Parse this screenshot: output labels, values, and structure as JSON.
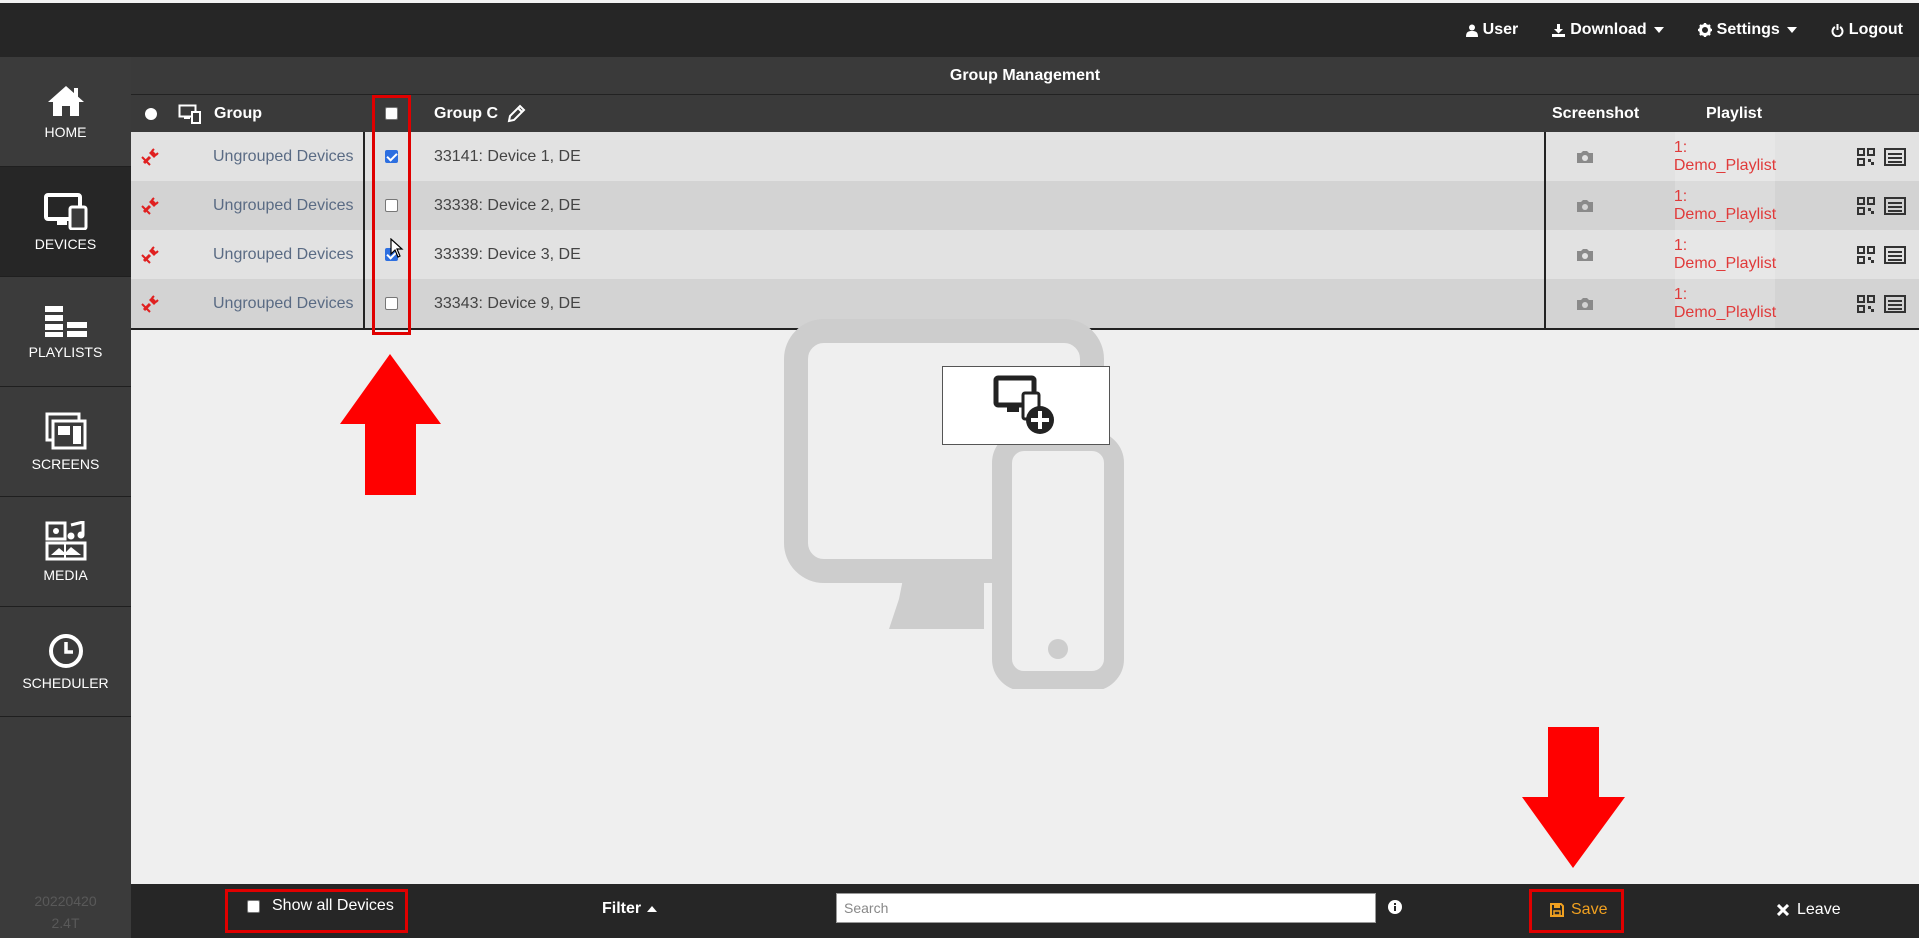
{
  "topbar": {
    "user": "User",
    "download": "Download",
    "settings": "Settings",
    "logout": "Logout"
  },
  "sidebar": {
    "items": [
      {
        "label": "HOME",
        "icon": "home-icon",
        "active": false
      },
      {
        "label": "DEVICES",
        "icon": "devices-icon",
        "active": true
      },
      {
        "label": "PLAYLISTS",
        "icon": "playlists-icon",
        "active": false
      },
      {
        "label": "SCREENS",
        "icon": "screens-icon",
        "active": false
      },
      {
        "label": "MEDIA",
        "icon": "media-icon",
        "active": false
      },
      {
        "label": "SCHEDULER",
        "icon": "clock-icon",
        "active": false
      }
    ],
    "version_line1": "20220420",
    "version_line2": "2.4T"
  },
  "main": {
    "title": "Group Management",
    "columns": {
      "group": "Group",
      "group_name": "Group C",
      "screenshot": "Screenshot",
      "playlist": "Playlist"
    },
    "rows": [
      {
        "group": "Ungrouped Devices",
        "checked": true,
        "device": "33141: Device 1, DE",
        "playlist": "1: Demo_Playlist"
      },
      {
        "group": "Ungrouped Devices",
        "checked": false,
        "device": "33338: Device 2, DE",
        "playlist": "1: Demo_Playlist"
      },
      {
        "group": "Ungrouped Devices",
        "checked": true,
        "device": "33339: Device 3, DE",
        "playlist": "1: Demo_Playlist"
      },
      {
        "group": "Ungrouped Devices",
        "checked": false,
        "device": "33343: Device 9, DE",
        "playlist": "1: Demo_Playlist"
      }
    ]
  },
  "bottombar": {
    "show_all": "Show all Devices",
    "filter": "Filter",
    "search_placeholder": "Search",
    "save": "Save",
    "leave": "Leave"
  },
  "colors": {
    "accent_red": "#e00000",
    "playlist_red": "#e03a3a",
    "save_orange": "#f0a020",
    "status_red": "#e02020"
  }
}
